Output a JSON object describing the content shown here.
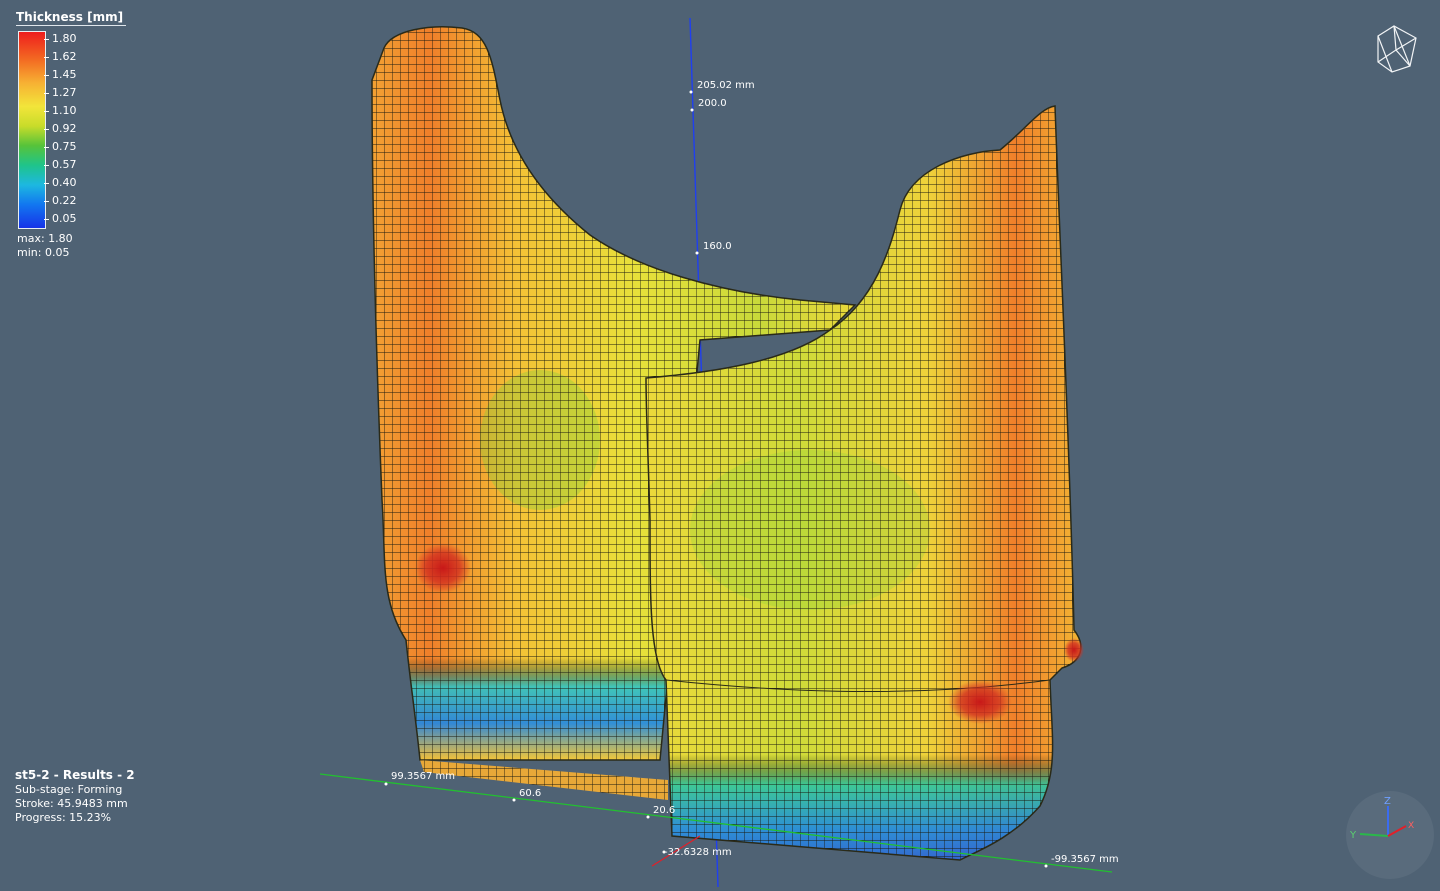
{
  "legend": {
    "title": "Thickness [mm]",
    "ticks": [
      "1.80",
      "1.62",
      "1.45",
      "1.27",
      "1.10",
      "0.92",
      "0.75",
      "0.57",
      "0.40",
      "0.22",
      "0.05"
    ],
    "max_label": "max: 1.80",
    "min_label": "min:  0.05"
  },
  "info": {
    "title": "st5-2 - Results - 2",
    "substage": "Sub-stage: Forming",
    "stroke": "Stroke: 45.9483 mm",
    "progress": "Progress: 15.23%"
  },
  "dimensions": {
    "z_top": "205.02 mm",
    "z_200": "200.0",
    "z_160": "160.0",
    "x_left": "99.3567 mm",
    "x_60": "60.6",
    "x_20": "20.6",
    "x_right": "-99.3567 mm",
    "y_neg": "-32.6328 mm"
  },
  "triad": {
    "z": "Z",
    "y": "Y",
    "x": "X"
  },
  "colors": {
    "background": "#4f6274",
    "z_axis": "#1f3ff0",
    "x_axis": "#22c030",
    "y_axis": "#e0202a"
  }
}
